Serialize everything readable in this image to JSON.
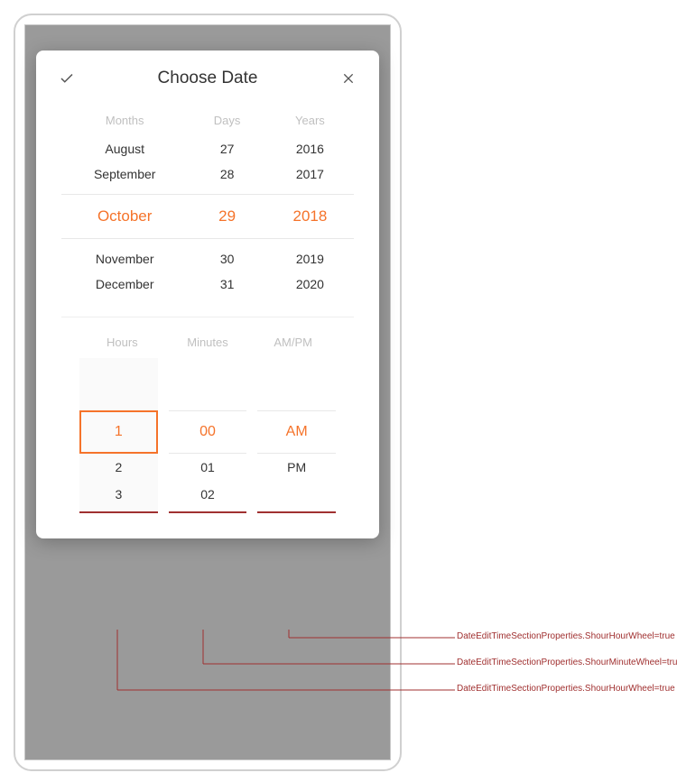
{
  "dialog": {
    "title": "Choose Date"
  },
  "date": {
    "headers": {
      "months": "Months",
      "days": "Days",
      "years": "Years"
    },
    "months_above": [
      "August",
      "September"
    ],
    "months_selected": "October",
    "months_below": [
      "November",
      "December"
    ],
    "days_above": [
      "27",
      "28"
    ],
    "days_selected": "29",
    "days_below": [
      "30",
      "31"
    ],
    "years_above": [
      "2016",
      "2017"
    ],
    "years_selected": "2018",
    "years_below": [
      "2019",
      "2020"
    ]
  },
  "time": {
    "headers": {
      "hours": "Hours",
      "minutes": "Minutes",
      "ampm": "AM/PM"
    },
    "hours_selected": "1",
    "hours_below": [
      "2",
      "3"
    ],
    "minutes_selected": "00",
    "minutes_below": [
      "01",
      "02"
    ],
    "ampm_selected": "AM",
    "ampm_below": [
      "PM"
    ]
  },
  "callouts": {
    "c1": "DateEditTimeSectionProperties.ShourHourWheel=true",
    "c2": "DateEditTimeSectionProperties.ShourMinuteWheel=true",
    "c3": "DateEditTimeSectionProperties.ShourHourWheel=true"
  },
  "colors": {
    "accent": "#f5732a",
    "annotation": "#a03030"
  }
}
